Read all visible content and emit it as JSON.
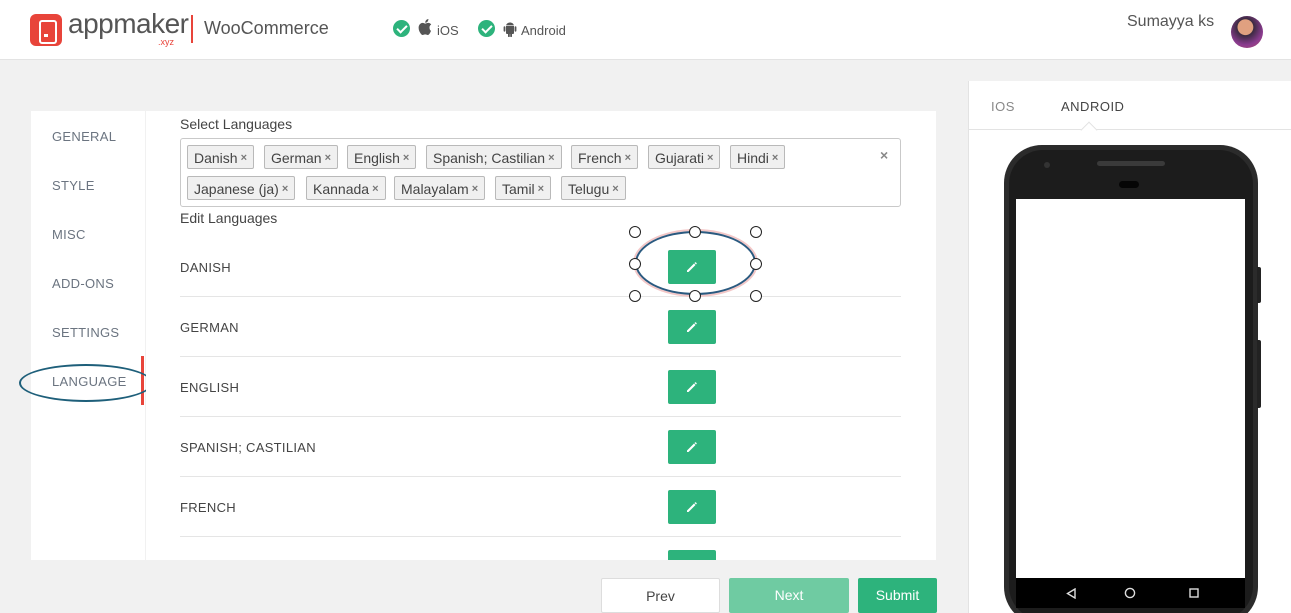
{
  "header": {
    "brand": "appmaker",
    "brand_suffix": ".xyz",
    "platform": "WooCommerce",
    "targets": [
      {
        "label": "iOS",
        "checked": true
      },
      {
        "label": "Android",
        "checked": true
      }
    ],
    "user_name": "Sumayya ks"
  },
  "sidebar": {
    "items": [
      {
        "label": "GENERAL"
      },
      {
        "label": "STYLE"
      },
      {
        "label": "MISC"
      },
      {
        "label": "ADD-ONS"
      },
      {
        "label": "SETTINGS"
      },
      {
        "label": "LANGUAGE",
        "active": true
      }
    ]
  },
  "main": {
    "select_label": "Select Languages",
    "selected_languages": [
      "Danish",
      "German",
      "English",
      "Spanish; Castilian",
      "French",
      "Gujarati",
      "Hindi",
      "Japanese (ja)",
      "Kannada",
      "Malayalam",
      "Tamil",
      "Telugu"
    ],
    "tag_remove": "×",
    "clear_all": "×",
    "edit_label": "Edit Languages",
    "edit_rows": [
      {
        "name": "DANISH"
      },
      {
        "name": "GERMAN"
      },
      {
        "name": "ENGLISH"
      },
      {
        "name": "SPANISH; CASTILIAN"
      },
      {
        "name": "FRENCH"
      },
      {
        "name": ""
      }
    ]
  },
  "footer": {
    "prev": "Prev",
    "next": "Next",
    "submit": "Submit"
  },
  "preview": {
    "tabs": [
      {
        "label": "IOS"
      },
      {
        "label": "ANDROID",
        "active": true
      }
    ]
  },
  "colors": {
    "accent": "#2db37c",
    "brand": "#e8443a",
    "next_disabled": "#6fcba2"
  }
}
